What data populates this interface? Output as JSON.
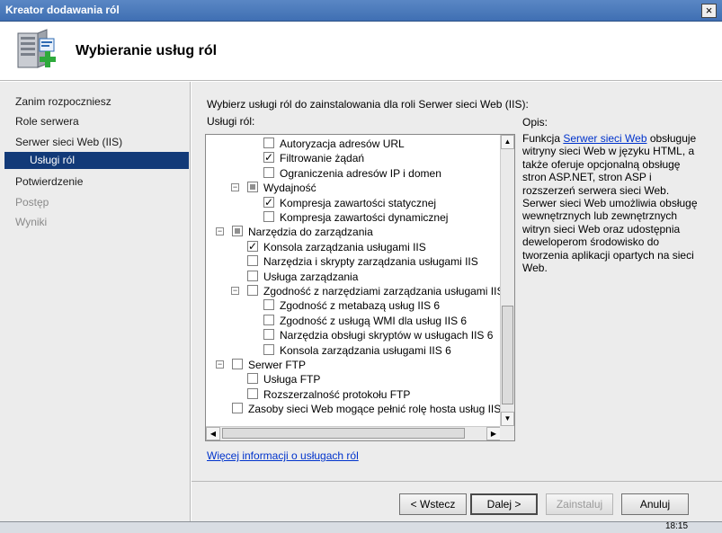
{
  "window": {
    "title": "Kreator dodawania ról",
    "close_glyph": "×"
  },
  "header": {
    "title": "Wybieranie usług ról"
  },
  "nav": {
    "items": [
      {
        "label": "Zanim rozpoczniesz",
        "state": "normal"
      },
      {
        "label": "Role serwera",
        "state": "normal"
      },
      {
        "label": "Serwer sieci Web (IIS)",
        "state": "normal"
      },
      {
        "label": "Usługi ról",
        "state": "selected"
      },
      {
        "label": "Potwierdzenie",
        "state": "normal"
      },
      {
        "label": "Postęp",
        "state": "disabled"
      },
      {
        "label": "Wyniki",
        "state": "disabled"
      }
    ]
  },
  "main": {
    "instruction": "Wybierz usługi ról do zainstalowania dla roli Serwer sieci Web (IIS):",
    "roles_label": "Usługi ról:",
    "description_label": "Opis:",
    "description_link": "Serwer sieci Web",
    "description_prefix": "Funkcja ",
    "description_text": " obsługuje witryny sieci Web w języku HTML, a także oferuje opcjonalną obsługę stron ASP.NET, stron ASP i rozszerzeń serwera sieci Web. Serwer sieci Web umożliwia obsługę wewnętrznych lub zewnętrznych witryn sieci Web oraz udostępnia deweloperom środowisko do tworzenia aplikacji opartych na sieci Web.",
    "more_info_link": "Więcej informacji o usługach ról"
  },
  "tree": [
    {
      "label": "Autoryzacja adresów URL",
      "level": 3,
      "check": "unchecked",
      "expander": ""
    },
    {
      "label": "Filtrowanie żądań",
      "level": 3,
      "check": "checked",
      "expander": ""
    },
    {
      "label": "Ograniczenia adresów IP i domen",
      "level": 3,
      "check": "unchecked",
      "expander": ""
    },
    {
      "label": "Wydajność",
      "level": 2,
      "check": "partial",
      "expander": "−"
    },
    {
      "label": "Kompresja zawartości statycznej",
      "level": 3,
      "check": "checked",
      "expander": ""
    },
    {
      "label": "Kompresja zawartości dynamicznej",
      "level": 3,
      "check": "unchecked",
      "expander": ""
    },
    {
      "label": "Narzędzia do zarządzania",
      "level": 1,
      "check": "partial",
      "expander": "−"
    },
    {
      "label": "Konsola zarządzania usługami IIS",
      "level": 2,
      "check": "checked",
      "expander": ""
    },
    {
      "label": "Narzędzia i skrypty zarządzania usługami IIS",
      "level": 2,
      "check": "unchecked",
      "expander": ""
    },
    {
      "label": "Usługa zarządzania",
      "level": 2,
      "check": "unchecked",
      "expander": ""
    },
    {
      "label": "Zgodność z narzędziami zarządzania usługami IIS w w",
      "level": 2,
      "check": "unchecked",
      "expander": "−"
    },
    {
      "label": "Zgodność z metabazą usług IIS 6",
      "level": 3,
      "check": "unchecked",
      "expander": ""
    },
    {
      "label": "Zgodność z usługą WMI dla usług IIS 6",
      "level": 3,
      "check": "unchecked",
      "expander": ""
    },
    {
      "label": "Narzędzia obsługi skryptów w usługach IIS 6",
      "level": 3,
      "check": "unchecked",
      "expander": ""
    },
    {
      "label": "Konsola zarządzania usługami IIS 6",
      "level": 3,
      "check": "unchecked",
      "expander": ""
    },
    {
      "label": "Serwer FTP",
      "level": 1,
      "check": "unchecked",
      "expander": "−"
    },
    {
      "label": "Usługa FTP",
      "level": 2,
      "check": "unchecked",
      "expander": ""
    },
    {
      "label": "Rozszerzalność protokołu FTP",
      "level": 2,
      "check": "unchecked",
      "expander": ""
    },
    {
      "label": "Zasoby sieci Web mogące pełnić rolę hosta usług IIS",
      "level": 1,
      "check": "unchecked",
      "expander": ""
    }
  ],
  "buttons": {
    "back": "< Wstecz",
    "next": "Dalej >",
    "install": "Zainstaluj",
    "cancel": "Anuluj"
  },
  "taskbar": {
    "clock": "18:15"
  },
  "colors": {
    "title_bar": "#3f6fb3",
    "nav_selected": "#123a78",
    "link": "#0033cc",
    "panel_bg": "#ececec"
  }
}
